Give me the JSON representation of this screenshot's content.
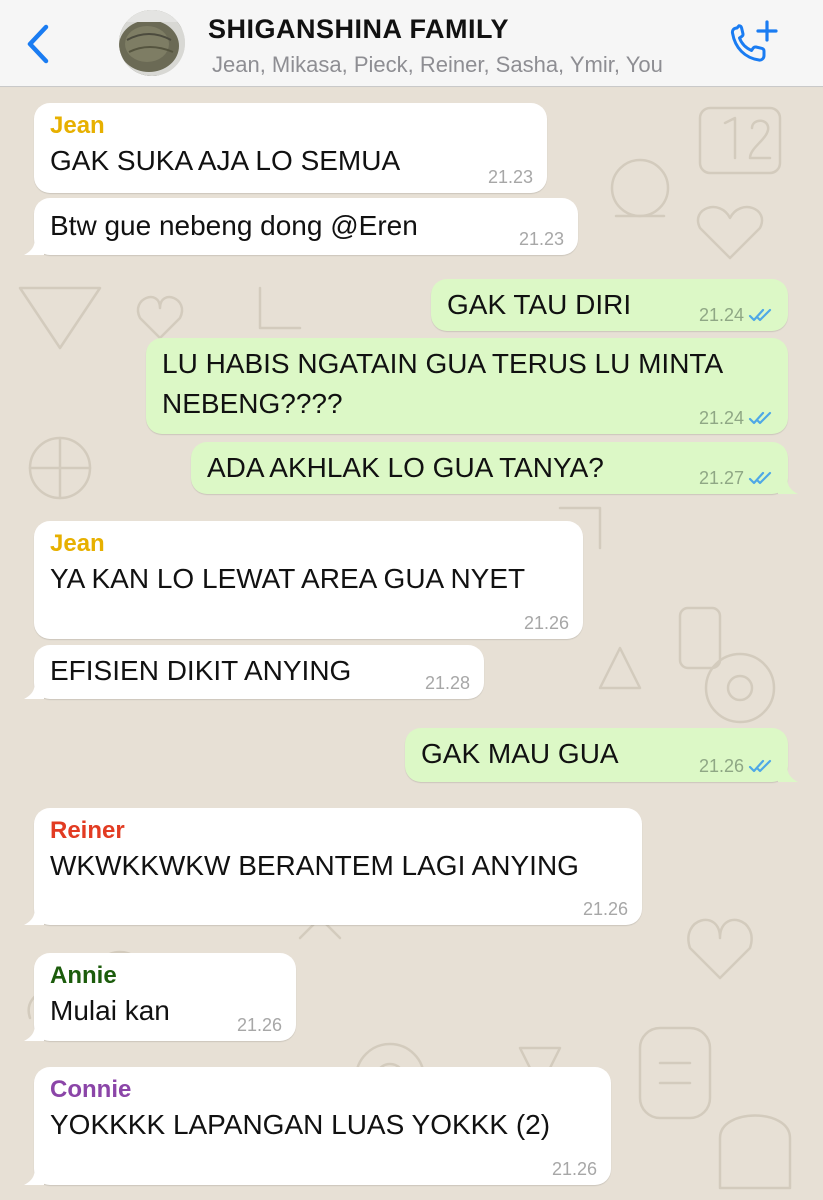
{
  "header": {
    "title": "SHIGANSHINA FAMILY",
    "participants": "Jean, Mikasa, Pieck, Reiner, Sasha, Ymir, You",
    "back_icon": "chevron-left-icon",
    "call_icon": "add-call-icon"
  },
  "colors": {
    "accent": "#1a7cf2",
    "incoming_bubble": "#ffffff",
    "outgoing_bubble": "#dcf8c6",
    "read_ticks": "#4fa8e6",
    "jean": "#e7b000",
    "reiner": "#e23b22",
    "annie": "#1c5c0c",
    "connie": "#8b45a8"
  },
  "messages": [
    {
      "sender": "Jean",
      "text": "GAK SUKA AJA LO SEMUA",
      "time": "21.23"
    },
    {
      "text": "Btw gue nebeng dong @Eren",
      "time": "21.23"
    },
    {
      "text": "GAK TAU DIRI",
      "time": "21.24"
    },
    {
      "text": "LU HABIS NGATAIN GUA TERUS LU MINTA",
      "text2": "NEBENG????",
      "time": "21.24"
    },
    {
      "text": "ADA AKHLAK LO GUA TANYA?",
      "time": "21.27"
    },
    {
      "sender": "Jean",
      "text": "YA KAN LO LEWAT AREA GUA NYET",
      "time": "21.26"
    },
    {
      "text": "EFISIEN DIKIT ANYING",
      "time": "21.28"
    },
    {
      "text": "GAK MAU GUA",
      "time": "21.26"
    },
    {
      "sender": "Reiner",
      "text": "WKWKKWKW BERANTEM LAGI ANYING",
      "time": "21.26"
    },
    {
      "sender": "Annie",
      "text": "Mulai kan",
      "time": "21.26"
    },
    {
      "sender": "Connie",
      "text": "YOKKKK LAPANGAN LUAS YOKKK (2)",
      "time": "21.26"
    }
  ]
}
